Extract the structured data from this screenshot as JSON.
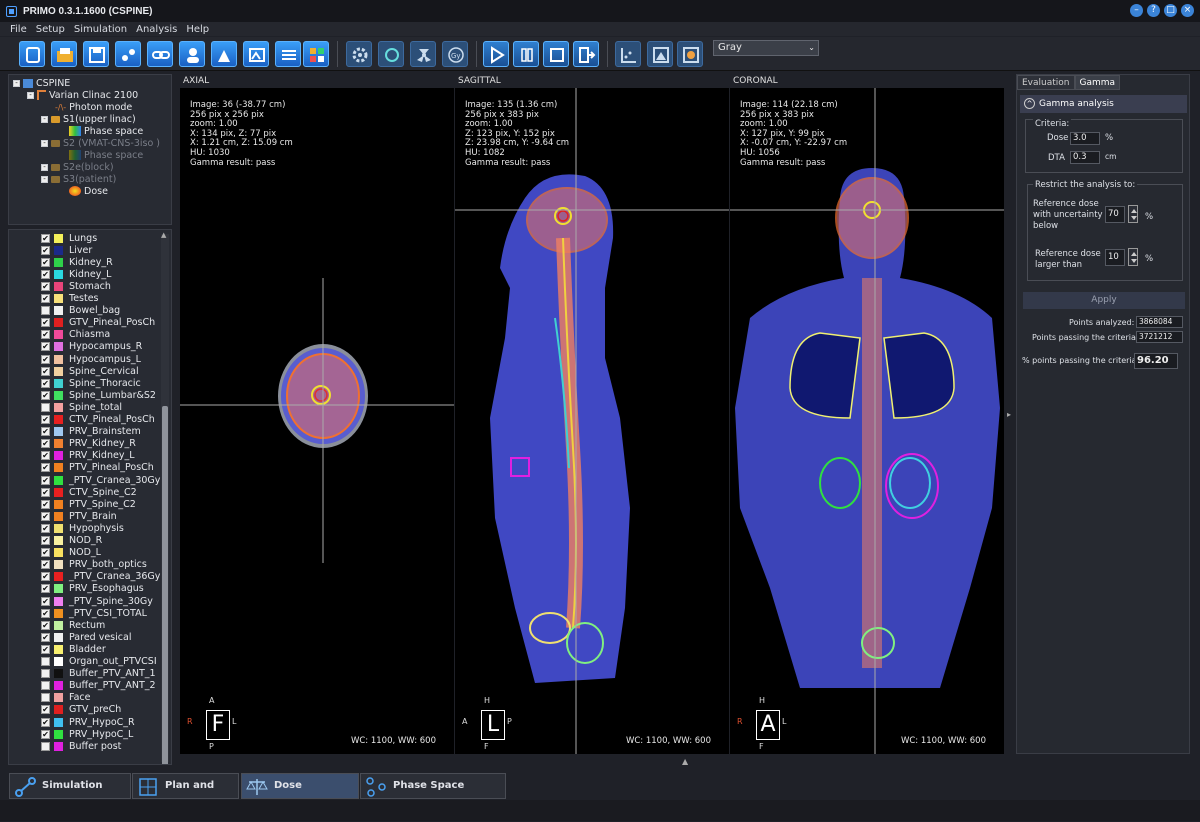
{
  "window": {
    "title": "PRIMO 0.3.1.1600 (CSPINE)",
    "buttons": [
      "minimize-icon",
      "help-icon",
      "maximize-icon",
      "close-icon"
    ]
  },
  "menu": [
    "File",
    "Setup",
    "Simulation",
    "Analysis",
    "Help"
  ],
  "toolbar": {
    "colormap": "Gray"
  },
  "tree": [
    {
      "label": "CSPINE",
      "indent": 0,
      "dim": false
    },
    {
      "label": "Varian Clinac 2100",
      "indent": 1,
      "dim": false
    },
    {
      "label": "Photon mode",
      "indent": 2,
      "dim": false
    },
    {
      "label": "S1(upper linac)",
      "indent": 2,
      "dim": false
    },
    {
      "label": "Phase space",
      "indent": 3,
      "dim": false
    },
    {
      "label": "S2 (VMAT-CNS-3iso )",
      "indent": 2,
      "dim": true
    },
    {
      "label": "Phase space",
      "indent": 3,
      "dim": true
    },
    {
      "label": "S2e(block)",
      "indent": 2,
      "dim": true
    },
    {
      "label": "S3(patient)",
      "indent": 2,
      "dim": true
    },
    {
      "label": "Dose",
      "indent": 3,
      "dim": false
    }
  ],
  "structures": [
    {
      "name": "Lungs",
      "color": "#f4f05a",
      "checked": true
    },
    {
      "name": "Liver",
      "color": "#1b2a8a",
      "checked": true
    },
    {
      "name": "Kidney_R",
      "color": "#2fd04a",
      "checked": true
    },
    {
      "name": "Kidney_L",
      "color": "#2ad8e0",
      "checked": true
    },
    {
      "name": "Stomach",
      "color": "#e8447a",
      "checked": true
    },
    {
      "name": "Testes",
      "color": "#f7e07a",
      "checked": true
    },
    {
      "name": "Bowel_bag",
      "color": "#f0f0f0",
      "checked": false
    },
    {
      "name": "GTV_Pineal_PosCh",
      "color": "#e02020",
      "checked": true
    },
    {
      "name": "Chiasma",
      "color": "#f04a9a",
      "checked": true
    },
    {
      "name": "Hypocampus_R",
      "color": "#e070e0",
      "checked": true
    },
    {
      "name": "Hypocampus_L",
      "color": "#f0c0a0",
      "checked": true
    },
    {
      "name": "Spine_Cervical",
      "color": "#f0d0a0",
      "checked": true
    },
    {
      "name": "Spine_Thoracic",
      "color": "#40d0d0",
      "checked": true
    },
    {
      "name": "Spine_Lumbar&S2",
      "color": "#40e060",
      "checked": true
    },
    {
      "name": "Spine_total",
      "color": "#f4a0a0",
      "checked": false
    },
    {
      "name": "CTV_Pineal_PosCh",
      "color": "#e82020",
      "checked": true
    },
    {
      "name": "PRV_Brainstem",
      "color": "#a0c8f0",
      "checked": true
    },
    {
      "name": "PRV_Kidney_R",
      "color": "#f08030",
      "checked": true
    },
    {
      "name": "PRV_Kidney_L",
      "color": "#e020e0",
      "checked": true
    },
    {
      "name": "PTV_Pineal_PosCh",
      "color": "#f08020",
      "checked": true
    },
    {
      "name": "_PTV_Cranea_30Gy",
      "color": "#30e040",
      "checked": true
    },
    {
      "name": "CTV_Spine_C2",
      "color": "#e82020",
      "checked": true
    },
    {
      "name": "PTV_Spine_C2",
      "color": "#f08020",
      "checked": true
    },
    {
      "name": "PTV_Brain",
      "color": "#f08020",
      "checked": true
    },
    {
      "name": "Hypophysis",
      "color": "#f0e070",
      "checked": true
    },
    {
      "name": "NOD_R",
      "color": "#f8f0a0",
      "checked": true
    },
    {
      "name": "NOD_L",
      "color": "#f8e060",
      "checked": true
    },
    {
      "name": "PRV_both_optics",
      "color": "#f0e0c0",
      "checked": true
    },
    {
      "name": "_PTV_Cranea_36Gy",
      "color": "#e82020",
      "checked": true
    },
    {
      "name": "PRV_Esophagus",
      "color": "#80f080",
      "checked": true
    },
    {
      "name": "_PTV_Spine_30Gy",
      "color": "#f080f0",
      "checked": true
    },
    {
      "name": "_PTV_CSI_TOTAL",
      "color": "#f09020",
      "checked": true
    },
    {
      "name": "Rectum",
      "color": "#c0f0a0",
      "checked": true
    },
    {
      "name": "Pared vesical",
      "color": "#f0f0f0",
      "checked": true
    },
    {
      "name": "Bladder",
      "color": "#f8f070",
      "checked": true
    },
    {
      "name": "Organ_out_PTVCSI",
      "color": "#ffffff",
      "checked": false
    },
    {
      "name": "Buffer_PTV_ANT_1",
      "color": "#101010",
      "checked": false
    },
    {
      "name": "Buffer_PTV_ANT_2",
      "color": "#e020e0",
      "checked": false
    },
    {
      "name": "Face",
      "color": "#f0a0a0",
      "checked": false
    },
    {
      "name": "GTV_preCh",
      "color": "#e02020",
      "checked": true
    },
    {
      "name": "PRV_HypoC_R",
      "color": "#40c0f0",
      "checked": true
    },
    {
      "name": "PRV_HypoC_L",
      "color": "#30e040",
      "checked": true
    },
    {
      "name": "Buffer post",
      "color": "#e020e0",
      "checked": false
    }
  ],
  "views": {
    "axial": {
      "label": "AXIAL",
      "info": [
        "Image: 36 (-38.77 cm)",
        "256 pix x 256 pix",
        "zoom:  1.00",
        "X: 134 pix, Z: 77 pix",
        "X: 1.21 cm, Z: 15.09 cm",
        "HU:  1030",
        "Gamma result: pass"
      ],
      "wc": "WC:  1100,  WW:   600",
      "orient": {
        "main": "F",
        "top": "A",
        "bottom": "P",
        "left": "R",
        "right": "L"
      }
    },
    "sagittal": {
      "label": "SAGITTAL",
      "info": [
        "Image: 135 (1.36 cm)",
        "256 pix x 383 pix",
        "zoom:  1.00",
        "Z: 123 pix, Y: 152 pix",
        "Z: 23.98 cm, Y: -9.64 cm",
        "HU:  1082",
        "Gamma result: pass"
      ],
      "wc": "WC:  1100,  WW:   600",
      "orient": {
        "main": "L",
        "top": "H",
        "bottom": "F",
        "left": "A",
        "right": "P"
      }
    },
    "coronal": {
      "label": "CORONAL",
      "info": [
        "Image: 114 (22.18 cm)",
        "256 pix x 383 pix",
        "zoom:  1.00",
        "X: 127 pix, Y: 99 pix",
        "X: -0.07 cm, Y: -22.97 cm",
        "HU:  1056",
        "Gamma result: pass"
      ],
      "wc": "WC:  1100,  WW:   600",
      "orient": {
        "main": "A",
        "top": "H",
        "bottom": "F",
        "left": "R",
        "right": "L"
      }
    }
  },
  "panel": {
    "tabs": [
      "Evaluation",
      "Gamma"
    ],
    "active_tab": "Gamma",
    "header": "Gamma analysis",
    "criteria": "Criteria:",
    "dose_label": "Dose",
    "dose_value": "3.0",
    "dose_unit": "%",
    "dta_label": "DTA",
    "dta_value": "0.3",
    "dta_unit": "cm",
    "restrict_label": "Restrict the analysis to:",
    "ref_unc_label_1": "Reference dose",
    "ref_unc_label_2": "with uncertainty",
    "ref_unc_label_3": "below",
    "ref_unc_value": "70",
    "ref_unc_unit": "%",
    "ref_large_label_1": "Reference dose",
    "ref_large_label_2": "larger than",
    "ref_large_value": "10",
    "ref_large_unit": "%",
    "apply": "Apply",
    "points_analyzed_label": "Points analyzed:",
    "points_analyzed": "3868084",
    "points_passing_label": "Points passing the criteria:",
    "points_passing": "3721212",
    "pct_label": "% points passing the criteria:",
    "pct": "96.20"
  },
  "bottom_tabs": [
    {
      "label": "Simulation Setup",
      "active": false
    },
    {
      "label": "Plan and Dose",
      "active": false
    },
    {
      "label": "Dose Evaluation",
      "active": true
    },
    {
      "label": "Phase Space Analysis",
      "active": false
    }
  ]
}
